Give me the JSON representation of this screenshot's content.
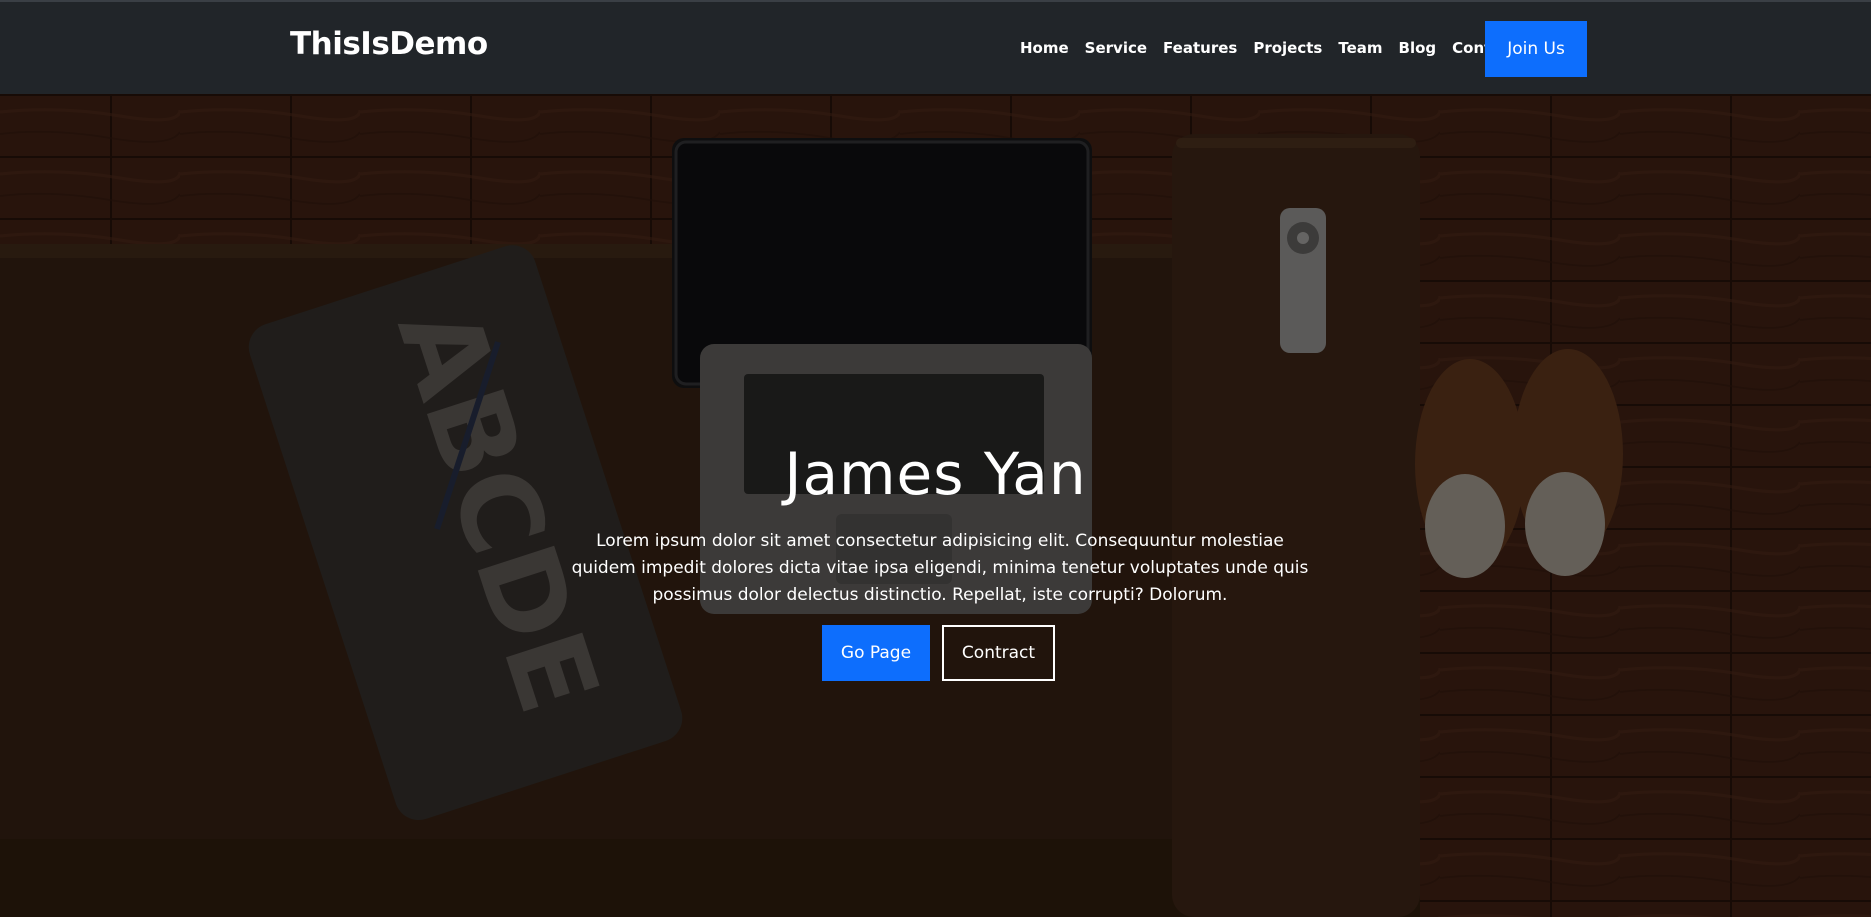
{
  "navbar": {
    "brand": "ThisIsDemo",
    "links": [
      "Home",
      "Service",
      "Features",
      "Projects",
      "Team",
      "Blog",
      "Contact"
    ],
    "cta_label": "Join Us"
  },
  "hero": {
    "title": "James Yan",
    "description": "Lorem ipsum dolor sit amet consectetur adipisicing elit. Consequuntur molestiae quidem impedit dolores dicta vitae ipsa eligendi, minima tenetur voluptates unde quis possimus dolor delectus distinctio. Repellat, iste corrupti? Dolorum.",
    "primary_button": "Go Page",
    "secondary_button": "Contract",
    "background_image": "laptop-on-sofa-photo"
  },
  "colors": {
    "navbar_bg": "#212529",
    "accent": "#0d6efd",
    "text": "#ffffff"
  }
}
